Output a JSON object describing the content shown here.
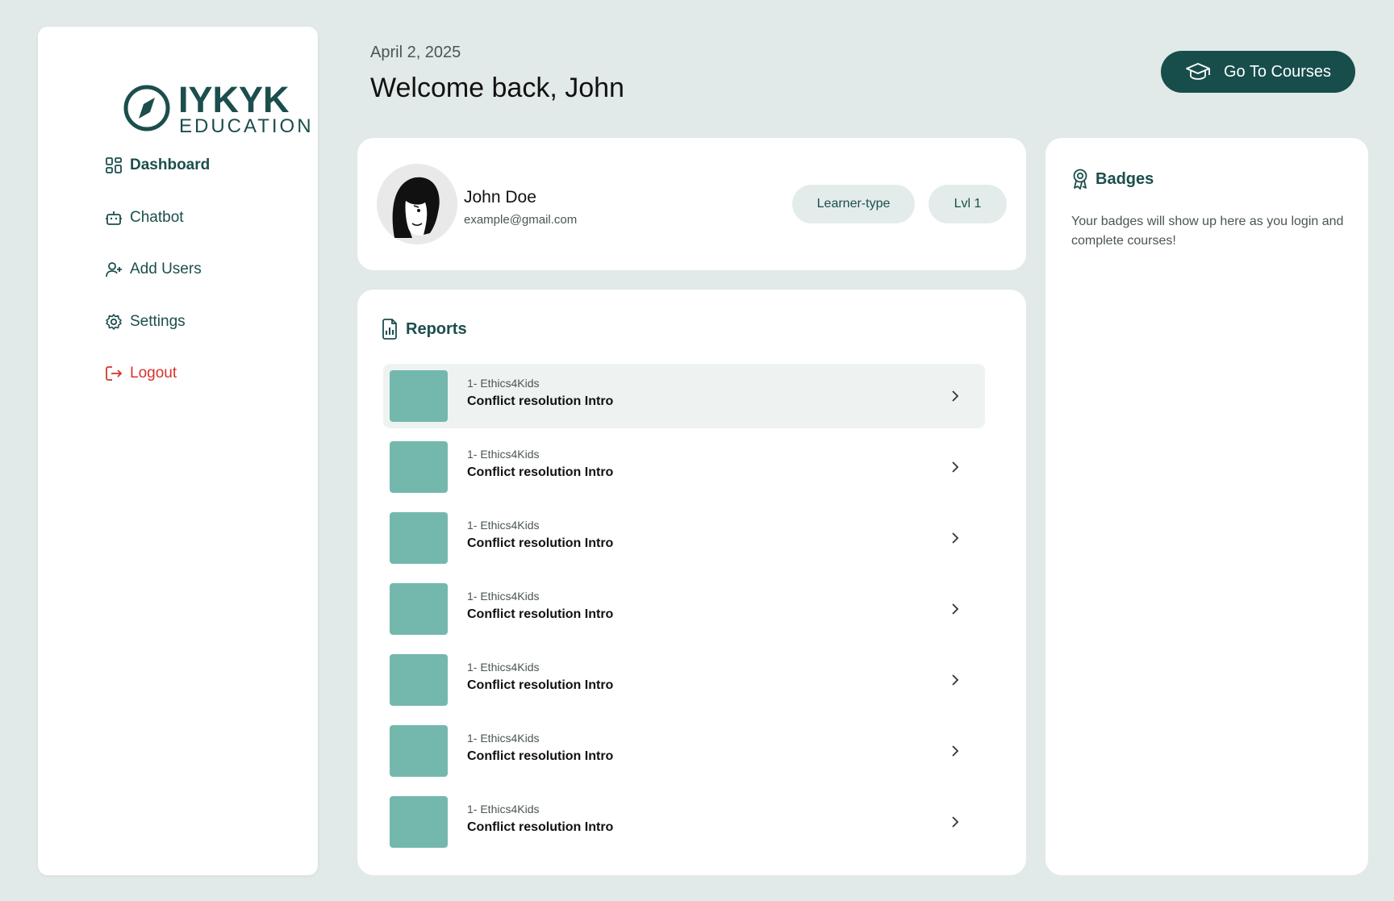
{
  "brand": {
    "name": "IYKYK",
    "subtitle": "EDUCATION",
    "color": "#1b4e4c"
  },
  "sidebar": {
    "items": [
      {
        "label": "Dashboard",
        "icon": "dashboard-grid-icon",
        "active": true
      },
      {
        "label": "Chatbot",
        "icon": "robot-icon"
      },
      {
        "label": "Add Users",
        "icon": "add-user-icon"
      },
      {
        "label": "Settings",
        "icon": "gear-icon"
      },
      {
        "label": "Logout",
        "icon": "logout-icon",
        "color": "#d6342b"
      }
    ]
  },
  "header": {
    "date": "April 2, 2025",
    "welcome": "Welcome back, John",
    "courses_button": "Go To Courses"
  },
  "profile": {
    "name": "John Doe",
    "email": "example@gmail.com",
    "learner_type": "Learner-type",
    "level": "Lvl 1"
  },
  "reports": {
    "title": "Reports",
    "items": [
      {
        "course": "1- Ethics4Kids",
        "title": "Conflict resolution Intro"
      },
      {
        "course": "1- Ethics4Kids",
        "title": "Conflict resolution Intro"
      },
      {
        "course": "1- Ethics4Kids",
        "title": "Conflict resolution Intro"
      },
      {
        "course": "1- Ethics4Kids",
        "title": "Conflict resolution Intro"
      },
      {
        "course": "1- Ethics4Kids",
        "title": "Conflict resolution Intro"
      },
      {
        "course": "1- Ethics4Kids",
        "title": "Conflict resolution Intro"
      },
      {
        "course": "1- Ethics4Kids",
        "title": "Conflict resolution Intro"
      }
    ]
  },
  "badges": {
    "title": "Badges",
    "empty_text": "Your badges will show up here as you login and complete courses!"
  },
  "colors": {
    "background": "#e1eae8",
    "primary": "#174e4c",
    "thumbnail": "#74b8ad",
    "logout": "#d6342b"
  }
}
